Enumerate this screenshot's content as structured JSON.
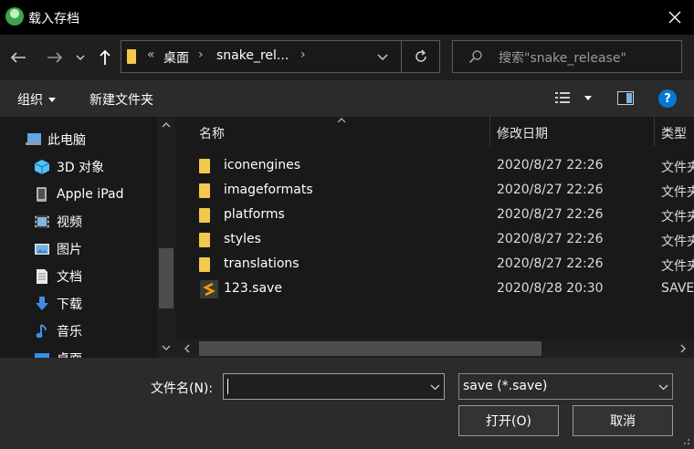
{
  "window": {
    "title": "载入存档",
    "close_icon": "×"
  },
  "nav": {
    "back_icon": "←",
    "forward_icon": "→",
    "recent_icon": "⌄",
    "up_icon": "↑",
    "address": {
      "overflow": "«",
      "crumbs": [
        "桌面",
        "snake_rel..."
      ],
      "sep": "›"
    },
    "refresh_icon": "↻",
    "search_placeholder": "搜索\"snake_release\""
  },
  "toolbar": {
    "organize_label": "组织",
    "new_folder_label": "新建文件夹",
    "help_label": "?"
  },
  "sidebar": {
    "items": [
      {
        "label": "此电脑",
        "icon": "computer-icon"
      },
      {
        "label": "3D 对象",
        "icon": "3d-objects-icon"
      },
      {
        "label": "Apple iPad",
        "icon": "device-icon"
      },
      {
        "label": "视频",
        "icon": "video-icon"
      },
      {
        "label": "图片",
        "icon": "pictures-icon"
      },
      {
        "label": "文档",
        "icon": "documents-icon"
      },
      {
        "label": "下载",
        "icon": "download-icon"
      },
      {
        "label": "音乐",
        "icon": "music-icon"
      },
      {
        "label": "桌面",
        "icon": "desktop-icon"
      }
    ]
  },
  "filelist": {
    "columns": [
      "名称",
      "修改日期",
      "类型"
    ],
    "rows": [
      {
        "name": "iconengines",
        "date": "2020/8/27 22:26",
        "type": "文件夹"
      },
      {
        "name": "imageformats",
        "date": "2020/8/27 22:26",
        "type": "文件夹"
      },
      {
        "name": "platforms",
        "date": "2020/8/27 22:26",
        "type": "文件夹"
      },
      {
        "name": "styles",
        "date": "2020/8/27 22:26",
        "type": "文件夹"
      },
      {
        "name": "translations",
        "date": "2020/8/27 22:26",
        "type": "文件夹"
      },
      {
        "name": "123.save",
        "date": "2020/8/28 20:30",
        "type": "SAVE"
      }
    ]
  },
  "footer": {
    "filename_label": "文件名(N):",
    "filename_value": "",
    "filter_value": "save (*.save)",
    "open_label": "打开(O)",
    "cancel_label": "取消"
  },
  "colors": {
    "accent": "#0078d7",
    "folder": "#f2c94c",
    "background": "#191919"
  }
}
